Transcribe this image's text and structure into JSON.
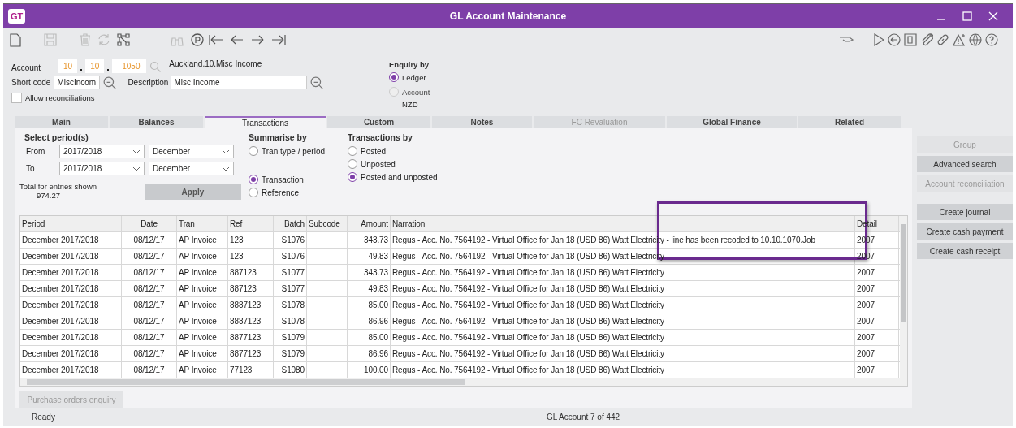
{
  "window": {
    "title": "GL Account Maintenance",
    "logo": "GT"
  },
  "account": {
    "label": "Account",
    "segments": [
      "10",
      "10",
      "1050"
    ],
    "name": "Auckland.10.Misc Income",
    "short_code_label": "Short code",
    "short_code": "MiscIncom",
    "description_label": "Description",
    "description": "Misc Income",
    "allow_reconciliations": {
      "label": "Allow reconciliations",
      "checked": false
    }
  },
  "enquiry_by": {
    "title": "Enquiry by",
    "options": [
      {
        "label": "Ledger",
        "selected": true,
        "disabled": false
      },
      {
        "label": "Account",
        "selected": false,
        "disabled": true
      }
    ],
    "currency": "NZD"
  },
  "tabs": [
    {
      "label": "Main",
      "selected": false,
      "disabled": false
    },
    {
      "label": "Balances",
      "selected": false,
      "disabled": false
    },
    {
      "label": "Transactions",
      "selected": true,
      "disabled": false
    },
    {
      "label": "Custom",
      "selected": false,
      "disabled": false
    },
    {
      "label": "Notes",
      "selected": false,
      "disabled": false
    },
    {
      "label": "FC Revaluation",
      "selected": false,
      "disabled": true
    },
    {
      "label": "Global Finance",
      "selected": false,
      "disabled": false
    },
    {
      "label": "Related",
      "selected": false,
      "disabled": false
    }
  ],
  "period": {
    "title": "Select period(s)",
    "from_label": "From",
    "from_year": "2017/2018",
    "from_month": "December",
    "to_label": "To",
    "to_year": "2017/2018",
    "to_month": "December"
  },
  "total": {
    "label": "Total for entries shown",
    "value": "974.27"
  },
  "apply": "Apply",
  "summarise_by": {
    "title": "Summarise by",
    "options": [
      {
        "label": "Tran type / period",
        "selected": false
      },
      {
        "label": "Transaction",
        "selected": true
      },
      {
        "label": "Reference",
        "selected": false
      }
    ]
  },
  "transactions_by": {
    "title": "Transactions by",
    "options": [
      {
        "label": "Posted",
        "selected": false
      },
      {
        "label": "Unposted",
        "selected": false
      },
      {
        "label": "Posted and unposted",
        "selected": true
      }
    ]
  },
  "table": {
    "columns": [
      "Period",
      "Date",
      "Tran",
      "Ref",
      "Batch",
      "Subcode",
      "Amount",
      "Narration",
      "Detail"
    ],
    "rows": [
      [
        "December 2017/2018",
        "08/12/17",
        "AP Invoice",
        "123",
        "S1076",
        "",
        "343.73",
        "Regus - Acc. No. 7564192 - Virtual Office for Jan 18 (USD 86) Watt Electricity - line has been recoded to 10.10.1070.Job",
        "2007"
      ],
      [
        "December 2017/2018",
        "08/12/17",
        "AP Invoice",
        "123",
        "S1076",
        "",
        "49.83",
        "Regus - Acc. No. 7564192 - Virtual Office for Jan 18 (USD 86) Watt Electricity",
        "2007"
      ],
      [
        "December 2017/2018",
        "08/12/17",
        "AP Invoice",
        "887123",
        "S1077",
        "",
        "343.73",
        "Regus - Acc. No. 7564192 - Virtual Office for Jan 18 (USD 86) Watt Electricity",
        "2007"
      ],
      [
        "December 2017/2018",
        "08/12/17",
        "AP Invoice",
        "887123",
        "S1077",
        "",
        "49.83",
        "Regus - Acc. No. 7564192 - Virtual Office for Jan 18 (USD 86) Watt Electricity",
        "2007"
      ],
      [
        "December 2017/2018",
        "08/12/17",
        "AP Invoice",
        "8887123",
        "S1078",
        "",
        "85.00",
        "Regus - Acc. No. 7564192 - Virtual Office for Jan 18 (USD 86) Watt Electricity",
        "2007"
      ],
      [
        "December 2017/2018",
        "08/12/17",
        "AP Invoice",
        "8887123",
        "S1078",
        "",
        "86.96",
        "Regus - Acc. No. 7564192 - Virtual Office for Jan 18 (USD 86) Watt Electricity",
        "2007"
      ],
      [
        "December 2017/2018",
        "08/12/17",
        "AP Invoice",
        "8877123",
        "S1079",
        "",
        "85.00",
        "Regus - Acc. No. 7564192 - Virtual Office for Jan 18 (USD 86) Watt Electricity",
        "2007"
      ],
      [
        "December 2017/2018",
        "08/12/17",
        "AP Invoice",
        "8877123",
        "S1079",
        "",
        "86.96",
        "Regus - Acc. No. 7564192 - Virtual Office for Jan 18 (USD 86) Watt Electricity",
        "2007"
      ],
      [
        "December 2017/2018",
        "08/12/17",
        "AP Invoice",
        "77123",
        "S1080",
        "",
        "100.00",
        "Regus - Acc. No. 7564192 - Virtual Office for Jan 18 (USD 86) Watt Electricity",
        "2007"
      ]
    ]
  },
  "purchase_orders_button": {
    "label": "Purchase orders enquiry",
    "disabled": true
  },
  "side_buttons": [
    [
      {
        "label": "Group",
        "disabled": true
      },
      {
        "label": "Advanced search",
        "disabled": false
      },
      {
        "label": "Account reconciliation",
        "disabled": true
      }
    ],
    [
      {
        "label": "Create journal",
        "disabled": false
      },
      {
        "label": "Create cash payment",
        "disabled": false
      },
      {
        "label": "Create cash receipt",
        "disabled": false
      }
    ]
  ],
  "status_bar": {
    "left": "Ready",
    "center": "GL Account 7 of 442"
  }
}
